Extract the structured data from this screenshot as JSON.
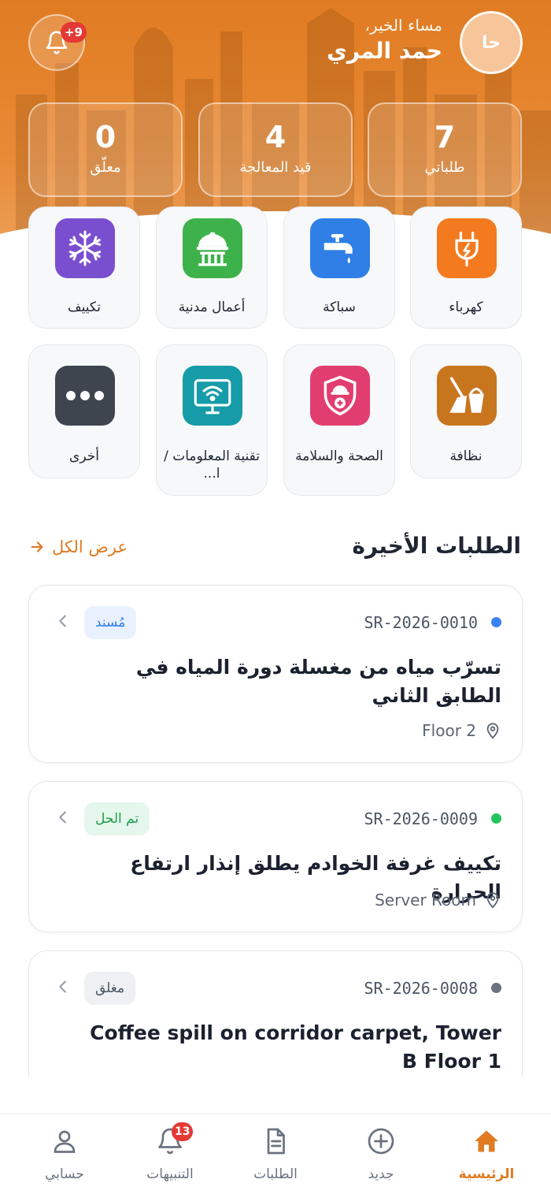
{
  "user": {
    "avatar_initials": "حا",
    "greeting": "مساء الخير،",
    "name": "حمد المري",
    "notification_badge": "+9"
  },
  "stats": [
    {
      "value": "7",
      "label": "طلباتي"
    },
    {
      "value": "4",
      "label": "قيد المعالجة"
    },
    {
      "value": "0",
      "label": "معلّق"
    }
  ],
  "categories": [
    {
      "label": "كهرباء",
      "icon": "electric-plug-icon",
      "color": "#f47a1f"
    },
    {
      "label": "سباكة",
      "icon": "water-tap-icon",
      "color": "#2f7fe6"
    },
    {
      "label": "أعمال مدنية",
      "icon": "helmet-building-icon",
      "color": "#3db24b"
    },
    {
      "label": "تكييف",
      "icon": "snowflake-icon",
      "color": "#7a4fcf"
    },
    {
      "label": "نظافة",
      "icon": "broom-bucket-icon",
      "color": "#c8761e"
    },
    {
      "label": "الصحة والسلامة",
      "icon": "safety-shield-icon",
      "color": "#e23d6f"
    },
    {
      "label": "تقنية المعلومات / ا...",
      "icon": "wifi-monitor-icon",
      "color": "#169ca8"
    },
    {
      "label": "أخرى",
      "icon": "more-dots-icon",
      "color": "#3f454f"
    }
  ],
  "recent": {
    "title": "الطلبات الأخيرة",
    "view_all": "عرض الكل"
  },
  "requests": [
    {
      "id": "SR-2026-0010",
      "status": "مُسند",
      "status_color": "#2f7fe6",
      "status_bg": "#e8f1fd",
      "dot_color": "#3b82f6",
      "title": "تسرّب مياه من مغسلة دورة المياه في الطابق الثاني",
      "location": "Floor 2"
    },
    {
      "id": "SR-2026-0009",
      "status": "تم الحل",
      "status_color": "#1e9e4a",
      "status_bg": "#e5f7ec",
      "dot_color": "#22c55e",
      "title": "تكييف غرفة الخوادم يطلق إنذار ارتفاع الحرارة",
      "location": "Server Room"
    },
    {
      "id": "SR-2026-0008",
      "status": "مغلق",
      "status_color": "#4b5563",
      "status_bg": "#eef0f3",
      "dot_color": "#6b7280",
      "title": "Coffee spill on corridor carpet, Tower B Floor 1",
      "location": ""
    }
  ],
  "nav": [
    {
      "label": "الرئيسية",
      "icon": "home-icon",
      "active": true
    },
    {
      "label": "جديد",
      "icon": "plus-circle-icon",
      "active": false
    },
    {
      "label": "الطلبات",
      "icon": "document-icon",
      "active": false
    },
    {
      "label": "التنبيهات",
      "icon": "bell-icon",
      "active": false,
      "badge": "13"
    },
    {
      "label": "حسابي",
      "icon": "user-icon",
      "active": false
    }
  ]
}
